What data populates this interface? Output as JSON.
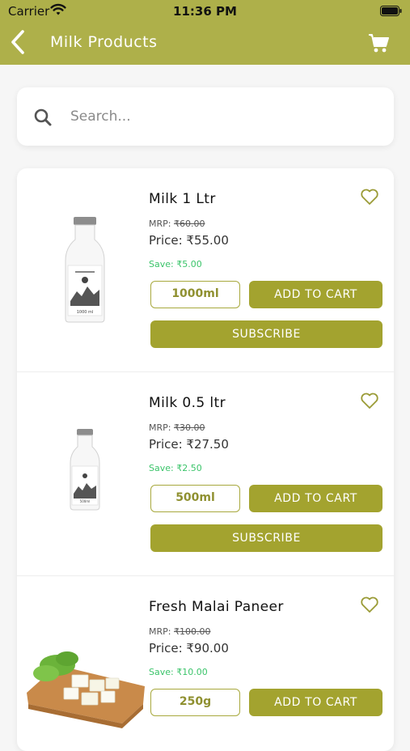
{
  "status_bar": {
    "carrier": "Carrier",
    "time": "11:36 PM"
  },
  "nav": {
    "title": "Milk Products",
    "back_icon": "chevron-left-icon",
    "cart_icon": "cart-icon"
  },
  "search": {
    "placeholder": "Search...",
    "value": ""
  },
  "colors": {
    "accent": "#a3a32f",
    "header": "#aeb04a",
    "save_green": "#3bc46a"
  },
  "products": [
    {
      "name": "Milk 1 Ltr",
      "mrp_label": "MRP:",
      "mrp_value": "₹60.00",
      "price": "Price: ₹55.00",
      "save": "Save: ₹5.00",
      "size": "1000ml",
      "add_label": "ADD TO CART",
      "subscribe_label": "SUBSCRIBE",
      "bottle_label": "1000 ml"
    },
    {
      "name": "Milk 0.5 ltr",
      "mrp_label": "MRP:",
      "mrp_value": "₹30.00",
      "price": "Price: ₹27.50",
      "save": "Save: ₹2.50",
      "size": "500ml",
      "add_label": "ADD TO CART",
      "subscribe_label": "SUBSCRIBE",
      "bottle_label": "500ml"
    },
    {
      "name": "Fresh Malai Paneer",
      "mrp_label": "MRP:",
      "mrp_value": "₹100.00",
      "price": "Price: ₹90.00",
      "save": "Save: ₹10.00",
      "size": "250g",
      "add_label": "ADD TO CART"
    }
  ]
}
